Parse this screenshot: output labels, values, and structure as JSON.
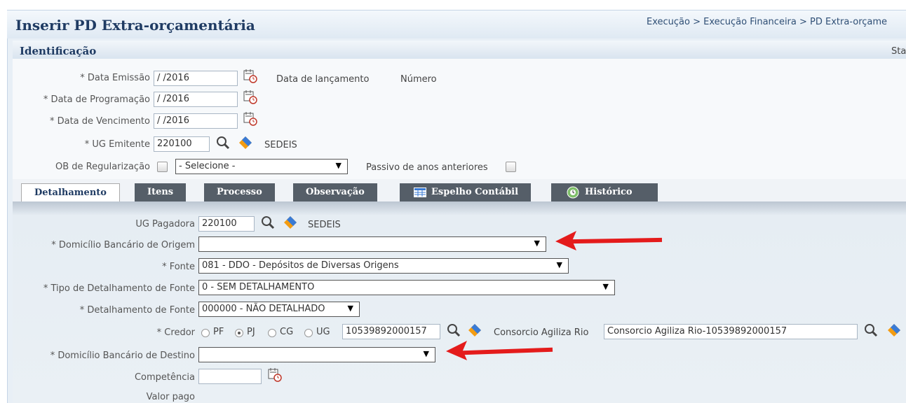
{
  "page": {
    "title": "Inserir PD Extra-orçamentária",
    "breadcrumb": "Execução > Execução Financeira > PD Extra-orçame"
  },
  "identificacao": {
    "title": "Identificação",
    "status_partial": "Sta",
    "data_emissao": {
      "label": "* Data Emissão",
      "value": "/   /2016"
    },
    "data_lancamento_label": "Data de lançamento",
    "numero_label": "Número",
    "data_programacao": {
      "label": "* Data de Programação",
      "value": "/   /2016"
    },
    "data_vencimento": {
      "label": "* Data de Vencimento",
      "value": "/   /2016"
    },
    "ug_emitente": {
      "label": "* UG Emitente",
      "value": "220100",
      "name": "SEDEIS"
    },
    "ob_regularizacao": {
      "label": "OB de Regularização",
      "select": "- Selecione -"
    },
    "passivo_label": "Passivo de anos anteriores"
  },
  "tabs": [
    "Detalhamento",
    "Itens",
    "Processo",
    "Observação",
    "Espelho Contábil",
    "Histórico"
  ],
  "detalhamento": {
    "ug_pagadora": {
      "label": "UG Pagadora",
      "value": "220100",
      "name": "SEDEIS"
    },
    "dom_origem": {
      "label": "* Domicílio Bancário de Origem",
      "value": ""
    },
    "fonte": {
      "label": "* Fonte",
      "value": "081 - DDO - Depósitos de Diversas Origens"
    },
    "tipo_det_fonte": {
      "label": "* Tipo de Detalhamento de Fonte",
      "value": "0 - SEM DETALHAMENTO"
    },
    "det_fonte": {
      "label": "* Detalhamento de Fonte",
      "value": "000000 - NÃO DETALHADO"
    },
    "credor": {
      "label": "* Credor",
      "options": [
        "PF",
        "PJ",
        "CG",
        "UG"
      ],
      "selected": "PJ",
      "value": "10539892000157",
      "name_label": "Consorcio Agiliza Rio",
      "name_value": "Consorcio Agiliza Rio-10539892000157"
    },
    "dom_destino": {
      "label": "* Domicílio Bancário de Destino",
      "value": ""
    },
    "competencia": {
      "label": "Competência",
      "value": ""
    },
    "valor_pago_label": "Valor pago"
  },
  "colors": {
    "annotation_arrow": "#e41b1b",
    "tab_dark": "#555e68",
    "title_blue": "#1f3b63"
  }
}
